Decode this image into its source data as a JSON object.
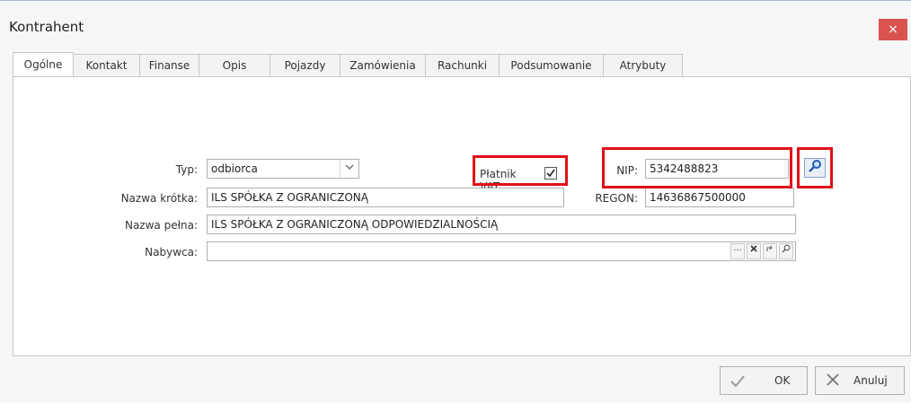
{
  "window": {
    "title": "Kontrahent",
    "close_glyph": "×"
  },
  "tabs": [
    {
      "label": "Ogólne",
      "active": true
    },
    {
      "label": "Kontakt",
      "active": false
    },
    {
      "label": "Finanse",
      "active": false
    },
    {
      "label": "Opis",
      "active": false
    },
    {
      "label": "Pojazdy",
      "active": false
    },
    {
      "label": "Zamówienia",
      "active": false
    },
    {
      "label": "Rachunki",
      "active": false
    },
    {
      "label": "Podsumowanie",
      "active": false
    },
    {
      "label": "Atrybuty",
      "active": false
    }
  ],
  "form": {
    "typ_label": "Typ:",
    "typ_value": "odbiorca",
    "platnik_vat_label": "Płatnik VAT",
    "platnik_vat_checked": true,
    "nip_label": "NIP:",
    "nip_value": "5342488823",
    "nazwa_krotka_label": "Nazwa krótka:",
    "nazwa_krotka_value": "ILS SPÓŁKA Z OGRANICZONĄ",
    "regon_label": "REGON:",
    "regon_value": "14636867500000",
    "nazwa_pelna_label": "Nazwa pełna:",
    "nazwa_pelna_value": "ILS SPÓŁKA Z OGRANICZONĄ ODPOWIEDZIALNOŚCIĄ",
    "nabywca_label": "Nabywca:",
    "nabywca_value": ""
  },
  "footer": {
    "ok_label": "OK",
    "cancel_label": "Anuluj"
  },
  "colors": {
    "highlight": "#e0101a",
    "close_button": "#d9534f"
  }
}
